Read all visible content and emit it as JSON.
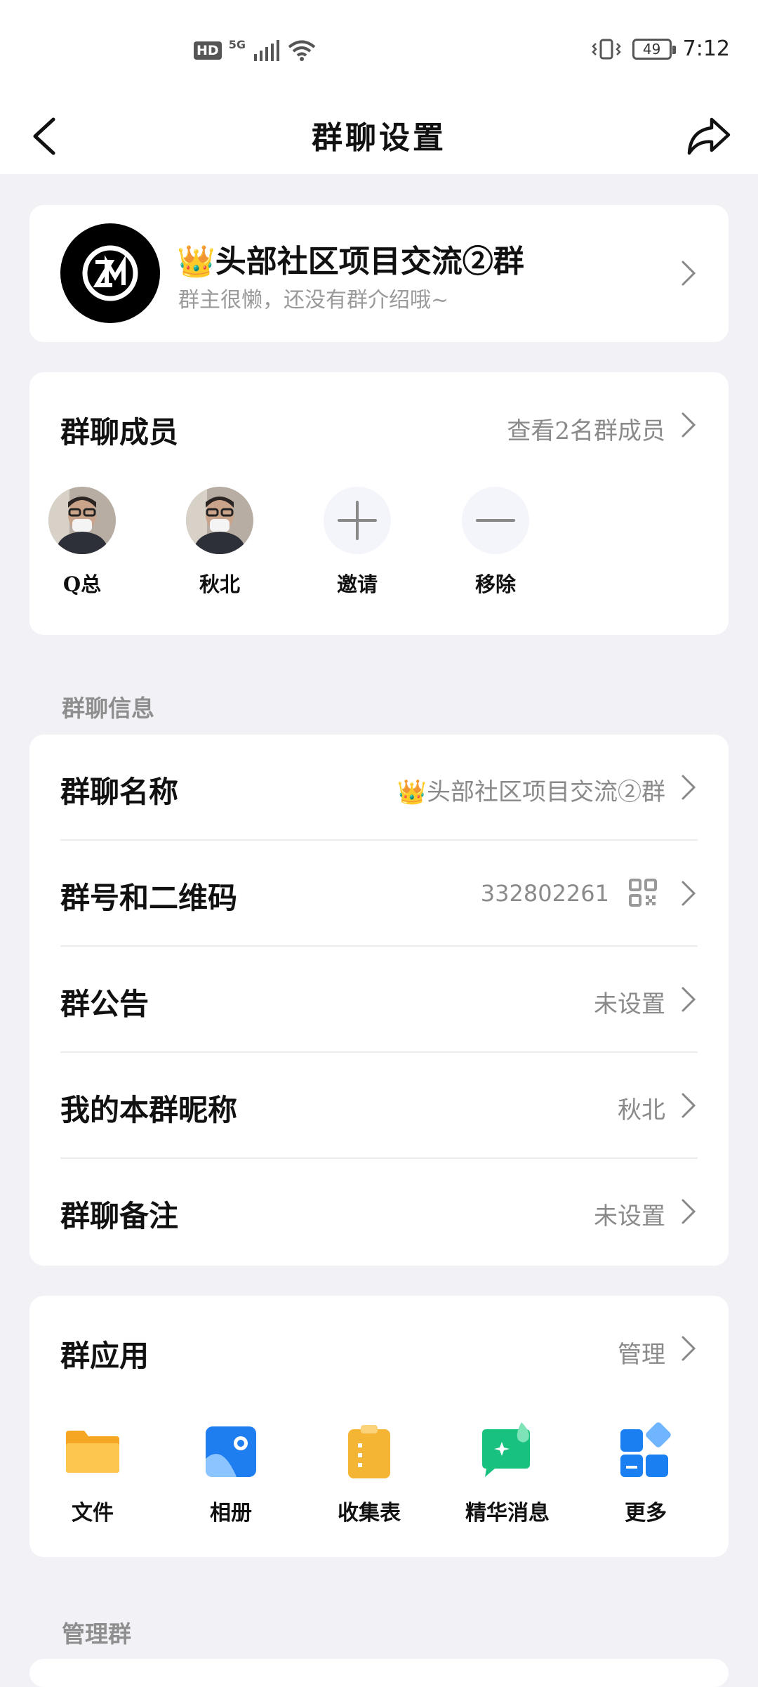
{
  "status_bar": {
    "hd": "HD",
    "network": "5G",
    "battery": "49",
    "time": "7:12"
  },
  "nav": {
    "title": "群聊设置"
  },
  "group": {
    "crown": "👑",
    "name": "头部社区项目交流②群",
    "intro": "群主很懒，还没有群介绍哦~",
    "avatar_text": "ZM"
  },
  "members": {
    "title": "群聊成员",
    "view_all": "查看2名群成员",
    "items": [
      {
        "label": "Q总"
      },
      {
        "label": "秋北"
      },
      {
        "label": "邀请"
      },
      {
        "label": "移除"
      }
    ]
  },
  "info_section": {
    "label": "群聊信息",
    "rows": [
      {
        "title": "群聊名称",
        "value": "👑头部社区项目交流②群"
      },
      {
        "title": "群号和二维码",
        "value": "332802261"
      },
      {
        "title": "群公告",
        "value": "未设置"
      },
      {
        "title": "我的本群昵称",
        "value": "秋北"
      },
      {
        "title": "群聊备注",
        "value": "未设置"
      }
    ]
  },
  "apps": {
    "title": "群应用",
    "manage": "管理",
    "items": [
      {
        "label": "文件",
        "icon": "folder-icon"
      },
      {
        "label": "相册",
        "icon": "album-icon"
      },
      {
        "label": "收集表",
        "icon": "form-icon"
      },
      {
        "label": "精华消息",
        "icon": "essence-message-icon"
      },
      {
        "label": "更多",
        "icon": "more-apps-icon"
      }
    ]
  },
  "manage_section": {
    "label": "管理群"
  },
  "colors": {
    "background": "#f1f1f6",
    "secondary_text": "#8a8a8a",
    "folder": "#f7b93a",
    "album": "#1e7ef0",
    "form": "#f5b534",
    "essence": "#19c17f",
    "more": "#1a7ff0"
  }
}
